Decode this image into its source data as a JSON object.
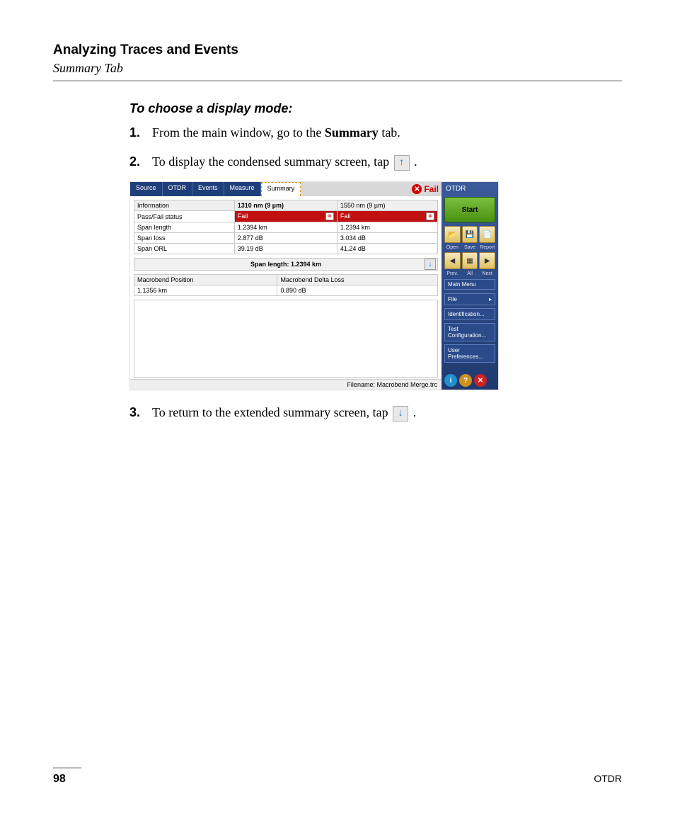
{
  "header": {
    "chapter": "Analyzing Traces and Events",
    "section": "Summary Tab"
  },
  "instruction_title": "To choose a display mode:",
  "steps": {
    "s1": {
      "num": "1.",
      "pre": "From the main window, go to the ",
      "bold": "Summary",
      "post": " tab."
    },
    "s2": {
      "num": "2.",
      "pre": "To display the condensed summary screen, tap ",
      "post": " ."
    },
    "s3": {
      "num": "3.",
      "pre": "To return to the extended summary screen, tap ",
      "post": " ."
    }
  },
  "screenshot": {
    "tabs": [
      "Source",
      "OTDR",
      "Events",
      "Measure",
      "Summary"
    ],
    "fail_label": "Fail",
    "info_table": {
      "headers": [
        "Information",
        "1310 nm (9 µm)",
        "1550 nm (9 µm)"
      ],
      "rows": [
        {
          "label": "Pass/Fail status",
          "c1": "Fail",
          "c2": "Fail",
          "fail": true
        },
        {
          "label": "Span length",
          "c1": "1.2394 km",
          "c2": "1.2394 km"
        },
        {
          "label": "Span loss",
          "c1": "2.877 dB",
          "c2": "3.034 dB"
        },
        {
          "label": "Span ORL",
          "c1": "39.19 dB",
          "c2": "41.24 dB"
        }
      ]
    },
    "span_bar": "Span length: 1.2394 km",
    "macro_table": {
      "headers": [
        "Macrobend Position",
        "Macrobend Delta Loss"
      ],
      "row": {
        "pos": "1.1356 km",
        "loss": "0.890 dB"
      }
    },
    "filename": "Filename: Macrobend Merge.trc",
    "side": {
      "title": "OTDR",
      "start": "Start",
      "row1_labels": [
        "Open",
        "Save",
        "Report"
      ],
      "row2_labels": [
        "Prev.",
        "All",
        "Next"
      ],
      "menu_header": "Main Menu",
      "menu_items": [
        "File",
        "Identification...",
        "Test Configuration...",
        "User Preferences..."
      ]
    }
  },
  "footer": {
    "page": "98",
    "doc": "OTDR"
  }
}
